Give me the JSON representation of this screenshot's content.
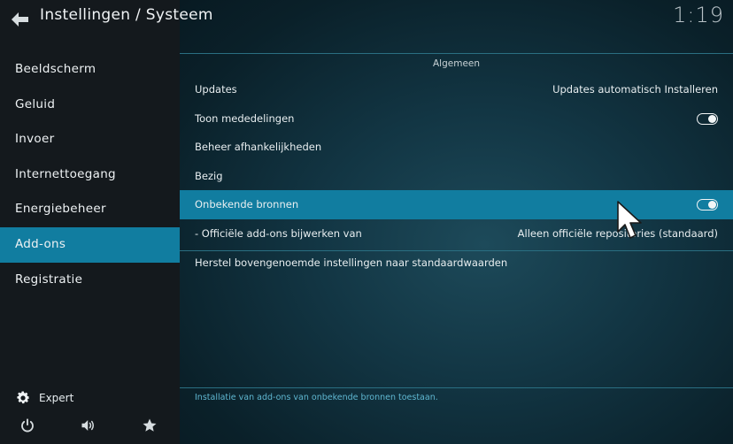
{
  "header": {
    "title": "Instellingen / Systeem",
    "clock": "1:19"
  },
  "sidebar": {
    "items": [
      {
        "label": "Beeldscherm"
      },
      {
        "label": "Geluid"
      },
      {
        "label": "Invoer"
      },
      {
        "label": "Internettoegang"
      },
      {
        "label": "Energiebeheer"
      },
      {
        "label": "Add-ons",
        "active": true
      },
      {
        "label": "Registratie"
      }
    ],
    "level_label": "Expert"
  },
  "main": {
    "section_title": "Algemeen",
    "rows": [
      {
        "label": "Updates",
        "value": "Updates automatisch Installeren"
      },
      {
        "label": "Toon mededelingen",
        "toggle": true
      },
      {
        "label": "Beheer afhankelijkheden"
      },
      {
        "label": "Bezig"
      },
      {
        "label": "Onbekende bronnen",
        "toggle": true,
        "active": true
      },
      {
        "label": "- Officiële add-ons bijwerken van",
        "value": "Alleen officiële repositories (standaard)"
      }
    ],
    "reset_label": "Herstel bovengenoemde instellingen naar standaardwaarden",
    "description": "Installatie van add-ons van onbekende bronnen toestaan."
  },
  "colors": {
    "accent": "#117da0",
    "sidebar_bg": "#14191d",
    "description_text": "#5fb7d1"
  }
}
